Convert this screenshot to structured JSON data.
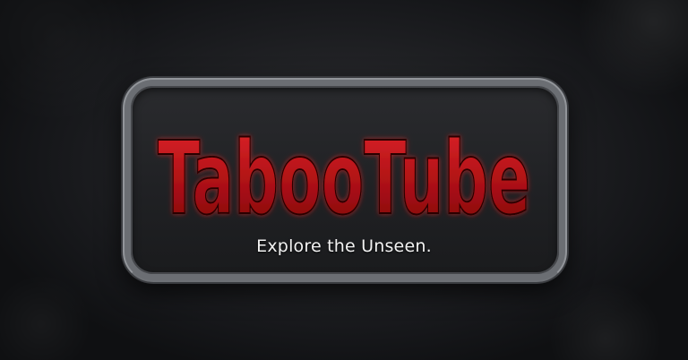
{
  "logo": {
    "brand_name": "TabooTube",
    "tagline": "Explore the Unseen.",
    "brand_color": "#c4161c",
    "frame_color": "#6b6e73",
    "background_color": "#222326"
  }
}
